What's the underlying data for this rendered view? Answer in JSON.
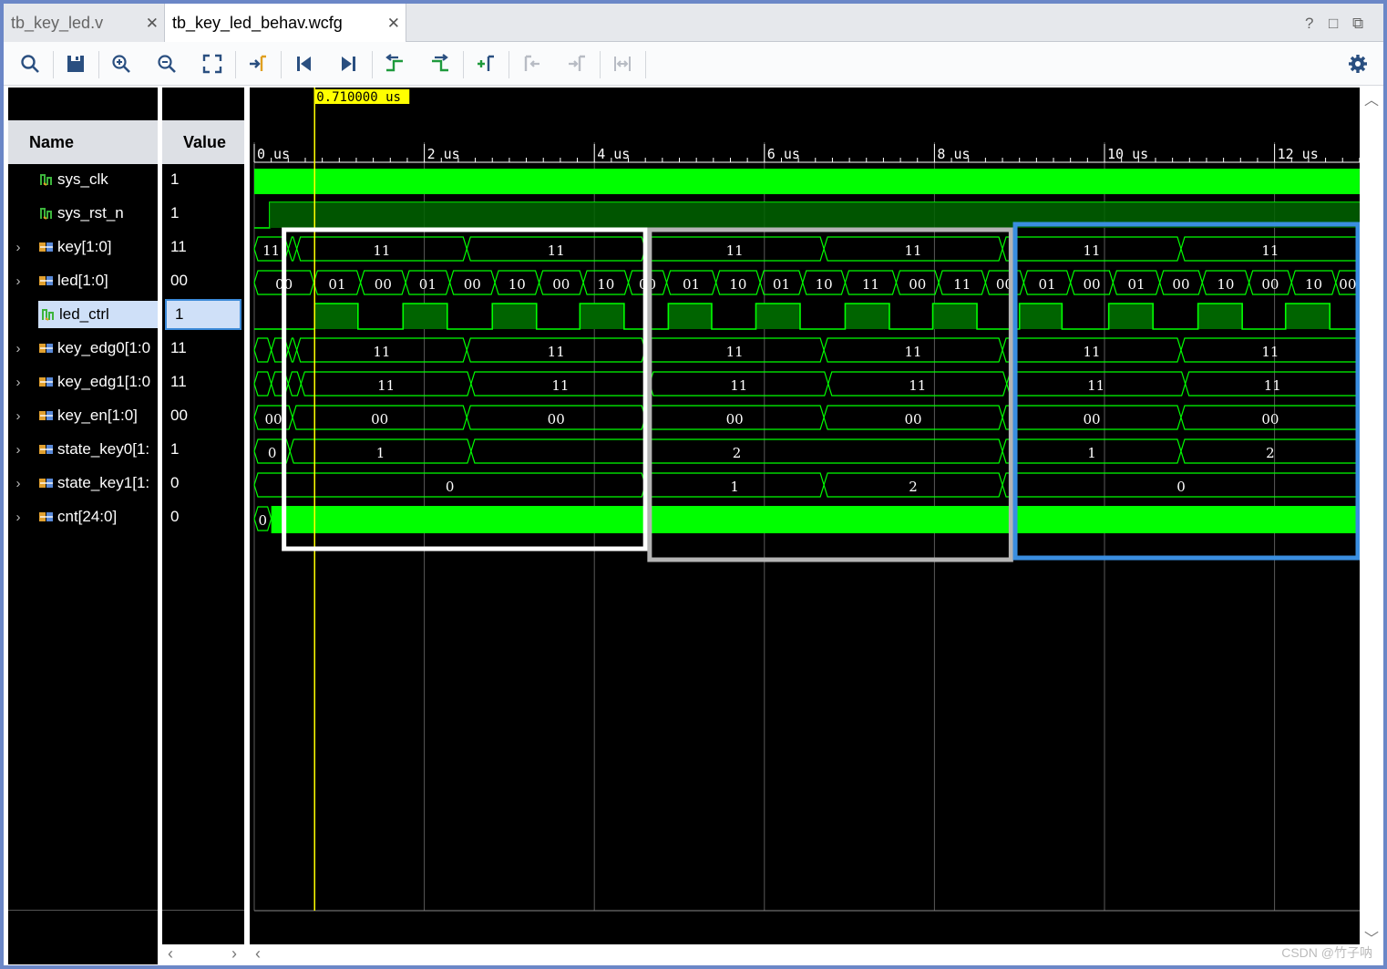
{
  "tabs": [
    {
      "label": "tb_key_led.v",
      "active": false
    },
    {
      "label": "tb_key_led_behav.wcfg",
      "active": true
    }
  ],
  "tab_controls": {
    "help": "?",
    "restore": "□",
    "maximize": "⧉"
  },
  "toolbar_icons": [
    "search-icon",
    "save-icon",
    "zoom-in-icon",
    "zoom-out-icon",
    "zoom-fit-icon",
    "goto-cursor-icon",
    "goto-start-icon",
    "goto-end-icon",
    "prev-transition-icon",
    "next-transition-icon",
    "add-marker-icon",
    "prev-marker-icon",
    "next-marker-icon",
    "swap-cursors-icon",
    "settings-gear-icon"
  ],
  "columns": {
    "name": "Name",
    "value": "Value"
  },
  "cursor": {
    "time": 0.71,
    "label": "0.710000 us"
  },
  "timeline": {
    "start": 0,
    "end": 13,
    "unit": "us",
    "ticks": [
      {
        "t": 0,
        "label": "0 us"
      },
      {
        "t": 2,
        "label": "2 us"
      },
      {
        "t": 4,
        "label": "4 us"
      },
      {
        "t": 6,
        "label": "6 us"
      },
      {
        "t": 8,
        "label": "8 us"
      },
      {
        "t": 10,
        "label": "10 us"
      },
      {
        "t": 12,
        "label": "12 us"
      }
    ]
  },
  "signals": [
    {
      "name": "sys_clk",
      "value": "1",
      "kind": "bit",
      "expand": false
    },
    {
      "name": "sys_rst_n",
      "value": "1",
      "kind": "bit",
      "expand": false
    },
    {
      "name": "key[1:0]",
      "value": "11",
      "kind": "bus",
      "expand": true
    },
    {
      "name": "led[1:0]",
      "value": "00",
      "kind": "bus",
      "expand": true
    },
    {
      "name": "led_ctrl",
      "value": "1",
      "kind": "bit",
      "expand": false,
      "selected": true
    },
    {
      "name": "key_edg0[1:0",
      "value": "11",
      "kind": "bus",
      "expand": true
    },
    {
      "name": "key_edg1[1:0",
      "value": "11",
      "kind": "bus",
      "expand": true
    },
    {
      "name": "key_en[1:0]",
      "value": "00",
      "kind": "bus",
      "expand": true
    },
    {
      "name": "state_key0[1:",
      "value": "1",
      "kind": "bus",
      "expand": true
    },
    {
      "name": "state_key1[1:",
      "value": "0",
      "kind": "bus",
      "expand": true
    },
    {
      "name": "cnt[24:0]",
      "value": "0",
      "kind": "bus",
      "expand": true
    }
  ],
  "waves": {
    "key": [
      {
        "t0": 0,
        "t1": 0.4,
        "v": "11"
      },
      {
        "t0": 0.4,
        "t1": 0.5,
        "v": ""
      },
      {
        "t0": 0.5,
        "t1": 2.5,
        "v": "11"
      },
      {
        "t0": 2.5,
        "t1": 4.6,
        "v": "11"
      },
      {
        "t0": 4.6,
        "t1": 6.7,
        "v": "11"
      },
      {
        "t0": 6.7,
        "t1": 8.8,
        "v": "11"
      },
      {
        "t0": 8.8,
        "t1": 10.9,
        "v": "11"
      },
      {
        "t0": 10.9,
        "t1": 13,
        "v": "11"
      }
    ],
    "led": [
      {
        "t0": 0,
        "t1": 0.7,
        "v": "00"
      },
      {
        "t0": 0.7,
        "t1": 1.25,
        "v": "01"
      },
      {
        "t0": 1.25,
        "t1": 1.78,
        "v": "00"
      },
      {
        "t0": 1.78,
        "t1": 2.3,
        "v": "01"
      },
      {
        "t0": 2.3,
        "t1": 2.83,
        "v": "00"
      },
      {
        "t0": 2.83,
        "t1": 3.35,
        "v": "10"
      },
      {
        "t0": 3.35,
        "t1": 3.87,
        "v": "00"
      },
      {
        "t0": 3.87,
        "t1": 4.4,
        "v": "10"
      },
      {
        "t0": 4.4,
        "t1": 4.85,
        "v": "00"
      },
      {
        "t0": 4.85,
        "t1": 5.43,
        "v": "01"
      },
      {
        "t0": 5.43,
        "t1": 5.95,
        "v": "10"
      },
      {
        "t0": 5.95,
        "t1": 6.45,
        "v": "01"
      },
      {
        "t0": 6.45,
        "t1": 6.95,
        "v": "10"
      },
      {
        "t0": 6.95,
        "t1": 7.55,
        "v": "11"
      },
      {
        "t0": 7.55,
        "t1": 8.05,
        "v": "00"
      },
      {
        "t0": 8.05,
        "t1": 8.6,
        "v": "11"
      },
      {
        "t0": 8.6,
        "t1": 9.05,
        "v": "00"
      },
      {
        "t0": 9.05,
        "t1": 9.6,
        "v": "01"
      },
      {
        "t0": 9.6,
        "t1": 10.1,
        "v": "00"
      },
      {
        "t0": 10.1,
        "t1": 10.65,
        "v": "01"
      },
      {
        "t0": 10.65,
        "t1": 11.15,
        "v": "00"
      },
      {
        "t0": 11.15,
        "t1": 11.7,
        "v": "10"
      },
      {
        "t0": 11.7,
        "t1": 12.2,
        "v": "00"
      },
      {
        "t0": 12.2,
        "t1": 12.72,
        "v": "10"
      },
      {
        "t0": 12.72,
        "t1": 13,
        "v": "00"
      }
    ],
    "led_ctrl_high": [
      [
        0.71,
        1.22
      ],
      [
        1.75,
        2.27
      ],
      [
        2.8,
        3.32
      ],
      [
        3.83,
        4.35
      ],
      [
        4.87,
        5.38
      ],
      [
        5.9,
        6.42
      ],
      [
        6.95,
        7.47
      ],
      [
        7.98,
        8.5
      ],
      [
        9.0,
        9.5
      ],
      [
        10.05,
        10.57
      ],
      [
        11.1,
        11.62
      ],
      [
        12.13,
        12.65
      ]
    ],
    "key_edg0": [
      {
        "t0": 0,
        "t1": 0.2,
        "v": ""
      },
      {
        "t0": 0.2,
        "t1": 0.4,
        "v": ""
      },
      {
        "t0": 0.4,
        "t1": 0.5,
        "v": ""
      },
      {
        "t0": 0.5,
        "t1": 2.5,
        "v": "11"
      },
      {
        "t0": 2.5,
        "t1": 4.6,
        "v": "11"
      },
      {
        "t0": 4.6,
        "t1": 6.7,
        "v": "11"
      },
      {
        "t0": 6.7,
        "t1": 8.8,
        "v": "11"
      },
      {
        "t0": 8.8,
        "t1": 10.9,
        "v": "11"
      },
      {
        "t0": 10.9,
        "t1": 13,
        "v": "11"
      }
    ],
    "key_edg1": [
      {
        "t0": 0,
        "t1": 0.2,
        "v": ""
      },
      {
        "t0": 0.2,
        "t1": 0.4,
        "v": ""
      },
      {
        "t0": 0.4,
        "t1": 0.55,
        "v": ""
      },
      {
        "t0": 0.55,
        "t1": 2.55,
        "v": "11"
      },
      {
        "t0": 2.55,
        "t1": 4.65,
        "v": "11"
      },
      {
        "t0": 4.65,
        "t1": 6.75,
        "v": "11"
      },
      {
        "t0": 6.75,
        "t1": 8.85,
        "v": "11"
      },
      {
        "t0": 8.85,
        "t1": 10.95,
        "v": "11"
      },
      {
        "t0": 10.95,
        "t1": 13,
        "v": "11"
      }
    ],
    "key_en": [
      {
        "t0": 0,
        "t1": 0.45,
        "v": "00"
      },
      {
        "t0": 0.45,
        "t1": 2.5,
        "v": "00"
      },
      {
        "t0": 2.5,
        "t1": 4.6,
        "v": "00"
      },
      {
        "t0": 4.6,
        "t1": 6.7,
        "v": "00"
      },
      {
        "t0": 6.7,
        "t1": 8.8,
        "v": "00"
      },
      {
        "t0": 8.8,
        "t1": 10.9,
        "v": "00"
      },
      {
        "t0": 10.9,
        "t1": 13,
        "v": "00"
      }
    ],
    "state_key0": [
      {
        "t0": 0,
        "t1": 0.42,
        "v": "0"
      },
      {
        "t0": 0.42,
        "t1": 2.55,
        "v": "1"
      },
      {
        "t0": 2.55,
        "t1": 8.8,
        "v": "2"
      },
      {
        "t0": 8.8,
        "t1": 10.9,
        "v": "1"
      },
      {
        "t0": 10.9,
        "t1": 13,
        "v": "2"
      }
    ],
    "state_key1": [
      {
        "t0": 0,
        "t1": 4.6,
        "v": "0"
      },
      {
        "t0": 4.6,
        "t1": 6.7,
        "v": "1"
      },
      {
        "t0": 6.7,
        "t1": 8.8,
        "v": "2"
      },
      {
        "t0": 8.8,
        "t1": 13,
        "v": "0"
      }
    ],
    "cnt": [
      {
        "t0": 0,
        "t1": 0.2,
        "v": "0"
      }
    ]
  },
  "annotations": [
    {
      "color": "#ffffff",
      "t0": 0.35,
      "t1": 4.6
    },
    {
      "color": "#b4b4b4",
      "t0": 4.65,
      "t1": 8.9
    },
    {
      "color": "#3a8ee0",
      "t0": 8.95,
      "t1": 13.15
    }
  ],
  "watermark": "CSDN @竹子呐"
}
